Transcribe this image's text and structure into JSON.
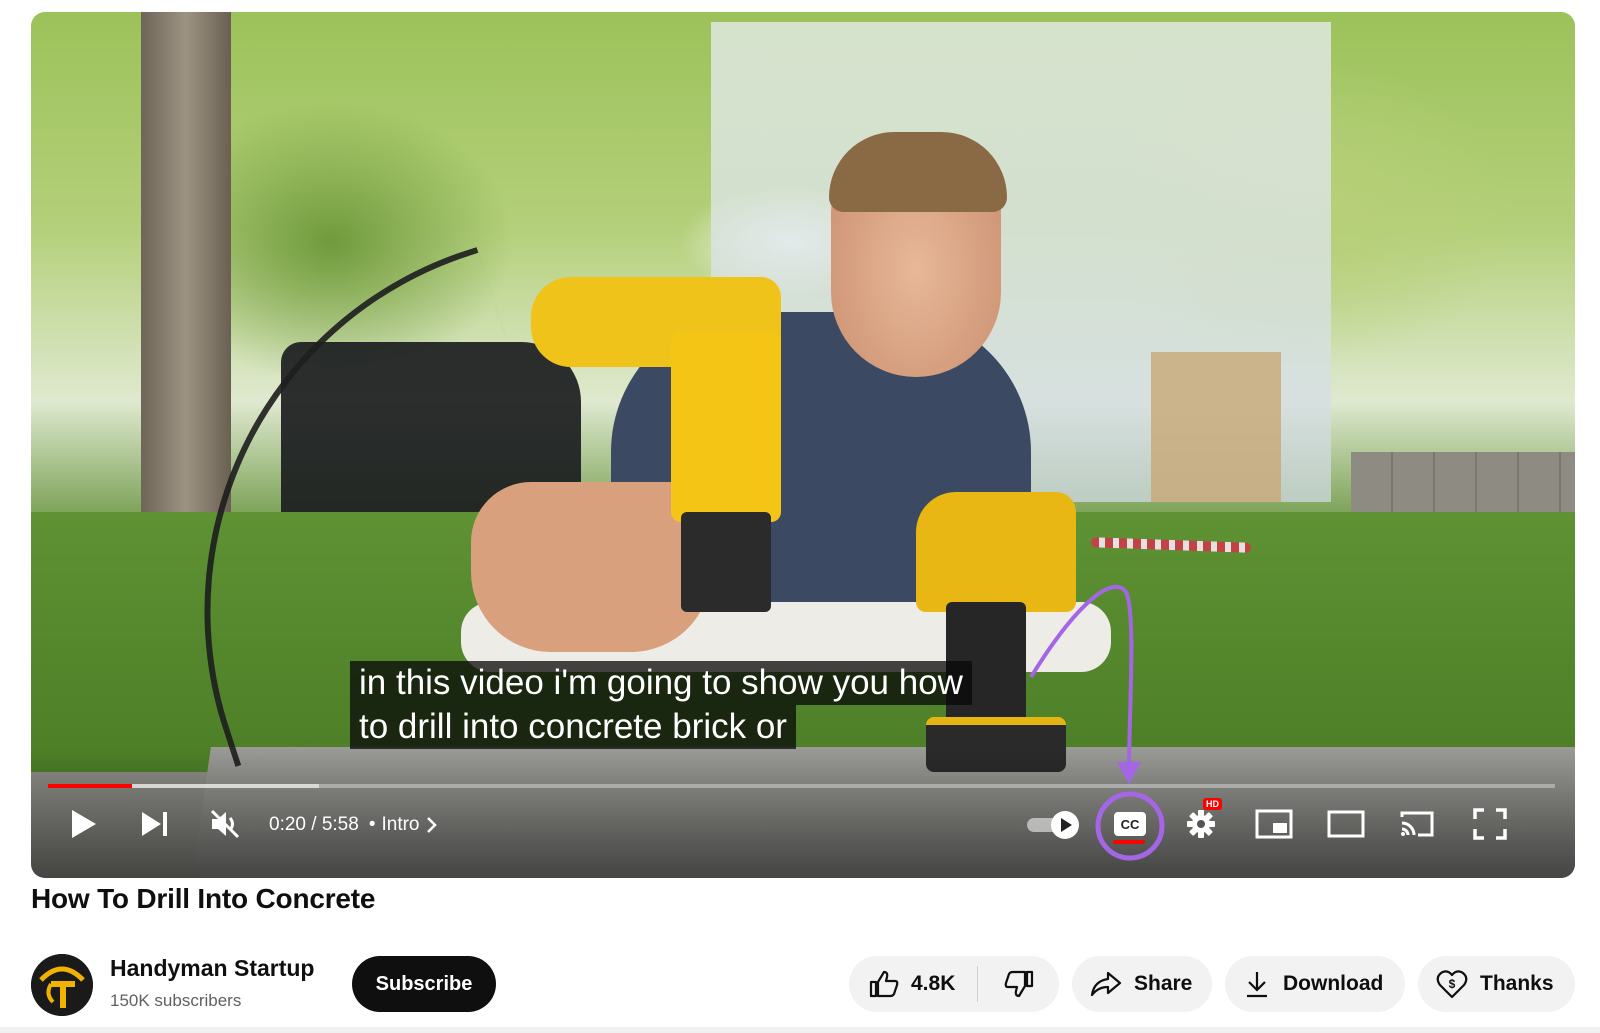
{
  "player": {
    "caption_line1": "in this video i'm going to show you how",
    "caption_line2": "to drill into concrete brick or",
    "current_time": "0:20",
    "time_separator": "/",
    "duration": "5:58",
    "chapter_dot": "•",
    "chapter": "Intro",
    "played_fraction": 0.056,
    "buffered_fraction": 0.18,
    "hd_badge": "HD",
    "cc_label": "CC",
    "annotation_color": "#a566e6",
    "progress_color": "#ff0000"
  },
  "video": {
    "title": "How To Drill Into Concrete"
  },
  "channel": {
    "name": "Handyman Startup",
    "subscribers": "150K subscribers",
    "subscribe_label": "Subscribe"
  },
  "actions": {
    "like_count": "4.8K",
    "share_label": "Share",
    "download_label": "Download",
    "thanks_label": "Thanks"
  },
  "icons": {
    "play": "play-icon",
    "next": "next-icon",
    "mute": "volume-muted-icon",
    "chevron": "chevron-right-icon",
    "autoplay": "autoplay-toggle-icon",
    "captions": "closed-captions-icon",
    "settings": "gear-icon",
    "miniplayer": "miniplayer-icon",
    "theater": "theater-mode-icon",
    "cast": "cast-icon",
    "fullscreen": "fullscreen-icon",
    "like": "thumbs-up-icon",
    "dislike": "thumbs-down-icon",
    "share": "share-arrow-icon",
    "download": "download-icon",
    "thanks": "heart-dollar-icon"
  }
}
